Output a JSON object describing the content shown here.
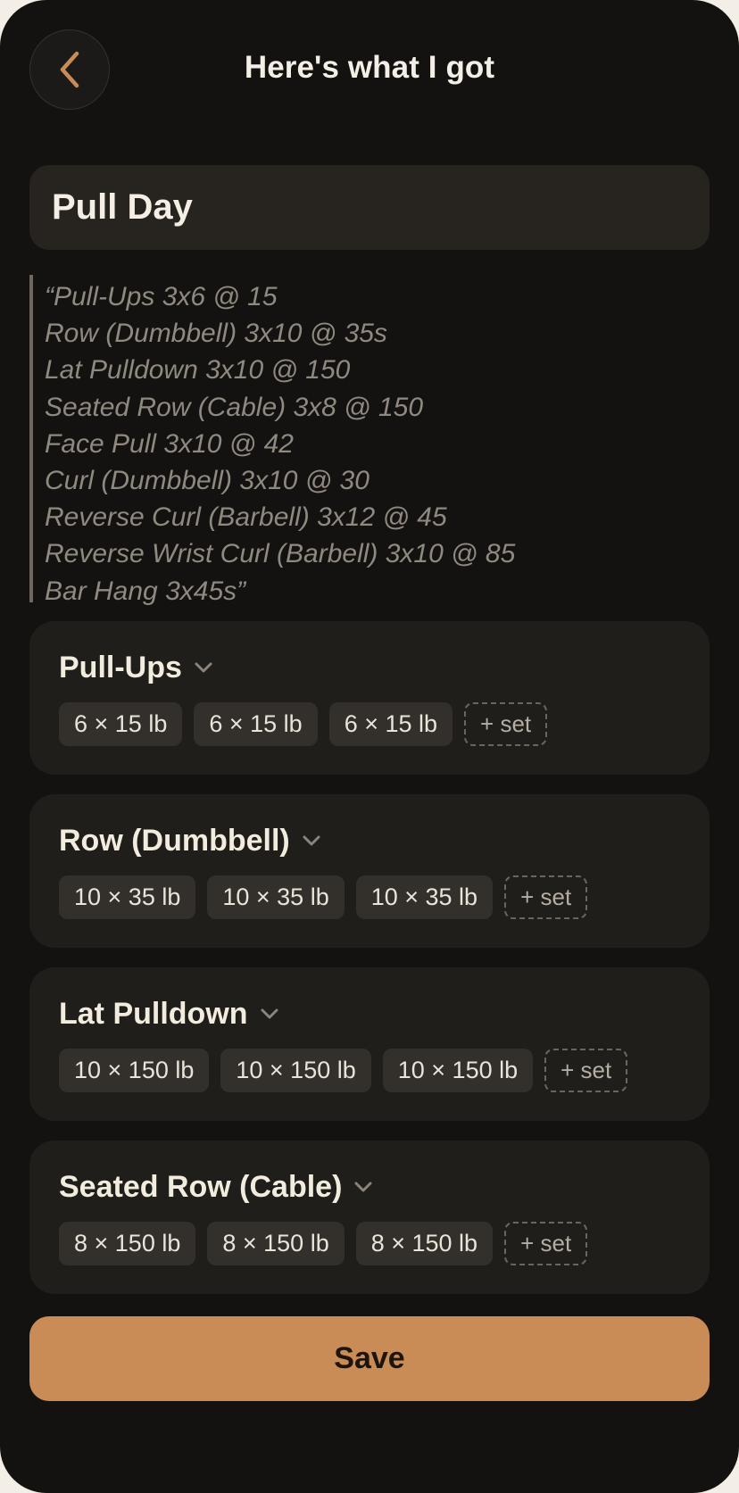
{
  "header": {
    "title": "Here's what I got",
    "back_icon": "chevron-left-icon"
  },
  "colors": {
    "background": "#141210",
    "card": "#201e1b",
    "accent": "#c98c56",
    "pill": "#33302c"
  },
  "workout": {
    "name": "Pull Day"
  },
  "quote": {
    "lines": [
      "“Pull-Ups 3x6 @ 15",
      "Row (Dumbbell) 3x10 @ 35s",
      "Lat Pulldown 3x10 @ 150",
      "Seated Row (Cable) 3x8 @ 150",
      "Face Pull 3x10 @ 42",
      "Curl (Dumbbell) 3x10 @ 30",
      "Reverse Curl (Barbell) 3x12 @ 45",
      "Reverse Wrist Curl (Barbell) 3x10 @ 85",
      "Bar Hang 3x45s”"
    ]
  },
  "exercises": [
    {
      "name": "Pull-Ups",
      "sets": [
        "6 × 15 lb",
        "6 × 15 lb",
        "6 × 15 lb"
      ],
      "add_set_label": "+ set"
    },
    {
      "name": "Row (Dumbbell)",
      "sets": [
        "10 × 35 lb",
        "10 × 35 lb",
        "10 × 35 lb"
      ],
      "add_set_label": "+ set"
    },
    {
      "name": "Lat Pulldown",
      "sets": [
        "10 × 150 lb",
        "10 × 150 lb",
        "10 × 150 lb"
      ],
      "add_set_label": "+ set"
    },
    {
      "name": "Seated Row (Cable)",
      "sets": [
        "8 × 150 lb",
        "8 × 150 lb",
        "8 × 150 lb"
      ],
      "add_set_label": "+ set"
    }
  ],
  "save_label": "Save"
}
